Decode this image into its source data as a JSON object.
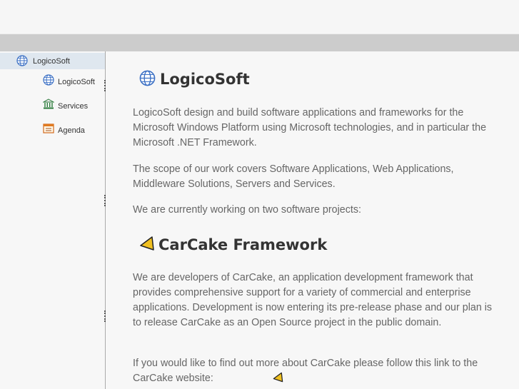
{
  "sidebar": {
    "root_label": "LogicoSoft",
    "items": [
      {
        "label": "LogicoSoft",
        "icon": "globe-icon"
      },
      {
        "label": "Services",
        "icon": "bank-icon"
      },
      {
        "label": "Agenda",
        "icon": "calendar-icon"
      }
    ]
  },
  "main": {
    "title": "LogicoSoft",
    "paragraphs": [
      "LogicoSoft design and build software applications and frameworks for the Microsoft Windows Platform using Microsoft technologies, and in particular the Microsoft .NET Framework.",
      "The scope of our work covers Software Applications, Web Applications, Middleware Solutions, Servers and Services.",
      "We are currently working on two software projects:"
    ],
    "carcake": {
      "title": "CarCake Framework",
      "paragraphs": [
        "We are developers of CarCake, an application development framework that provides comprehensive support for a variety of commercial and enterprise applications. Development is now entering its pre-release phase and our plan is to release CarCake as an Open Source project in the public domain.",
        "If you would like to find out more about CarCake please follow this link to the CarCake website:"
      ]
    }
  },
  "colors": {
    "accent_yellow": "#f0c020",
    "globe_blue": "#3a6fc4",
    "sidebar_selected": "#dfe7ef"
  }
}
